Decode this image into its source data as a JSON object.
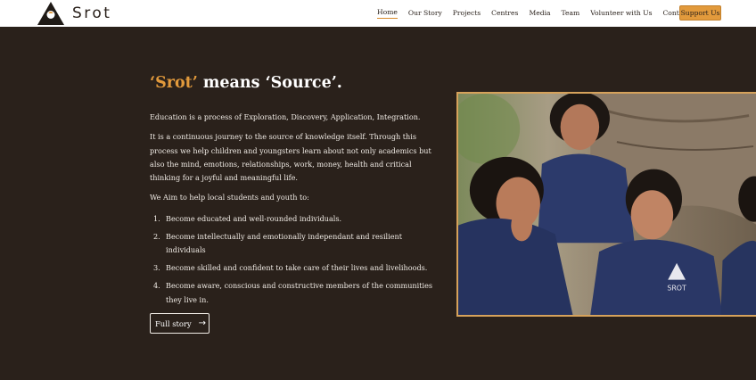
{
  "brand": {
    "name": "Srot"
  },
  "nav": {
    "items": [
      {
        "label": "Home",
        "active": true
      },
      {
        "label": "Our Story"
      },
      {
        "label": "Projects"
      },
      {
        "label": "Centres"
      },
      {
        "label": "Media"
      },
      {
        "label": "Team"
      },
      {
        "label": "Volunteer with Us"
      },
      {
        "label": "Contact Us"
      }
    ],
    "support_label": "Support Us"
  },
  "hero": {
    "headline_accent": "‘Srot’",
    "headline_rest": " means ‘Source’.",
    "p1": "Education is a process of Exploration, Discovery, Application, Integration.",
    "p2": "It is a continuous journey to the source of knowledge itself. Through this process we help children and youngsters learn about not only academics but also the mind, emotions, relationships, work, money, health and critical thinking for a joyful and meaningful life.",
    "p3": "We Aim to help local students and youth to:",
    "aims": [
      {
        "num": "1.",
        "text": "Become educated and well-rounded individuals."
      },
      {
        "num": "2.",
        "text": "Become intellectually and emotionally independant and resilient individuals"
      },
      {
        "num": "3.",
        "text": "Become skilled and confident to take care of their lives and livelihoods."
      },
      {
        "num": "4.",
        "text": "Become aware, conscious and constructive members of the communities they live in."
      }
    ],
    "cta_label": "Full story",
    "cta_icon": "arrow-right-icon",
    "photo_badge": "SROT"
  },
  "colors": {
    "accent": "#e29a3c",
    "background": "#2a211b",
    "nav_bg": "#ffffff"
  }
}
